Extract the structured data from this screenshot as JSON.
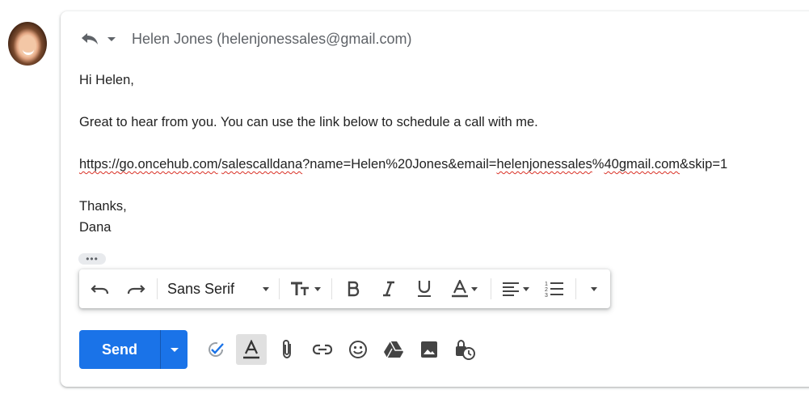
{
  "header": {
    "recipient": "Helen Jones (helenjonessales@gmail.com)",
    "reply_icon": "reply-icon"
  },
  "body": {
    "greeting": "Hi Helen,",
    "paragraph": "Great to hear from you. You can use the link below to schedule a call with me.",
    "link_parts": [
      "https://",
      "go.oncehub.com",
      "/",
      "salescalldana",
      "?name=Helen%20Jones&email=",
      "helenjonessales",
      "%",
      "40gmail.com",
      "&skip=1"
    ],
    "signoff_1": "Thanks,",
    "signoff_2": "Dana"
  },
  "trimmed_content_label": "•••",
  "formatting": {
    "font_family": "Sans Serif",
    "icons": [
      "undo-icon",
      "redo-icon",
      "font-size-icon",
      "bold-icon",
      "italic-icon",
      "underline-icon",
      "text-color-icon",
      "align-icon",
      "numbered-list-icon",
      "more-formatting-icon"
    ]
  },
  "compose": {
    "send_label": "Send",
    "tools": [
      "check-icon",
      "formatting-toggle-icon",
      "attach-icon",
      "link-icon",
      "emoji-icon",
      "drive-icon",
      "photo-icon",
      "confidential-icon"
    ]
  },
  "colors": {
    "accent": "#1a73e8",
    "spellcheck": "#d93025",
    "text": "#222222",
    "muted": "#5f6368"
  }
}
